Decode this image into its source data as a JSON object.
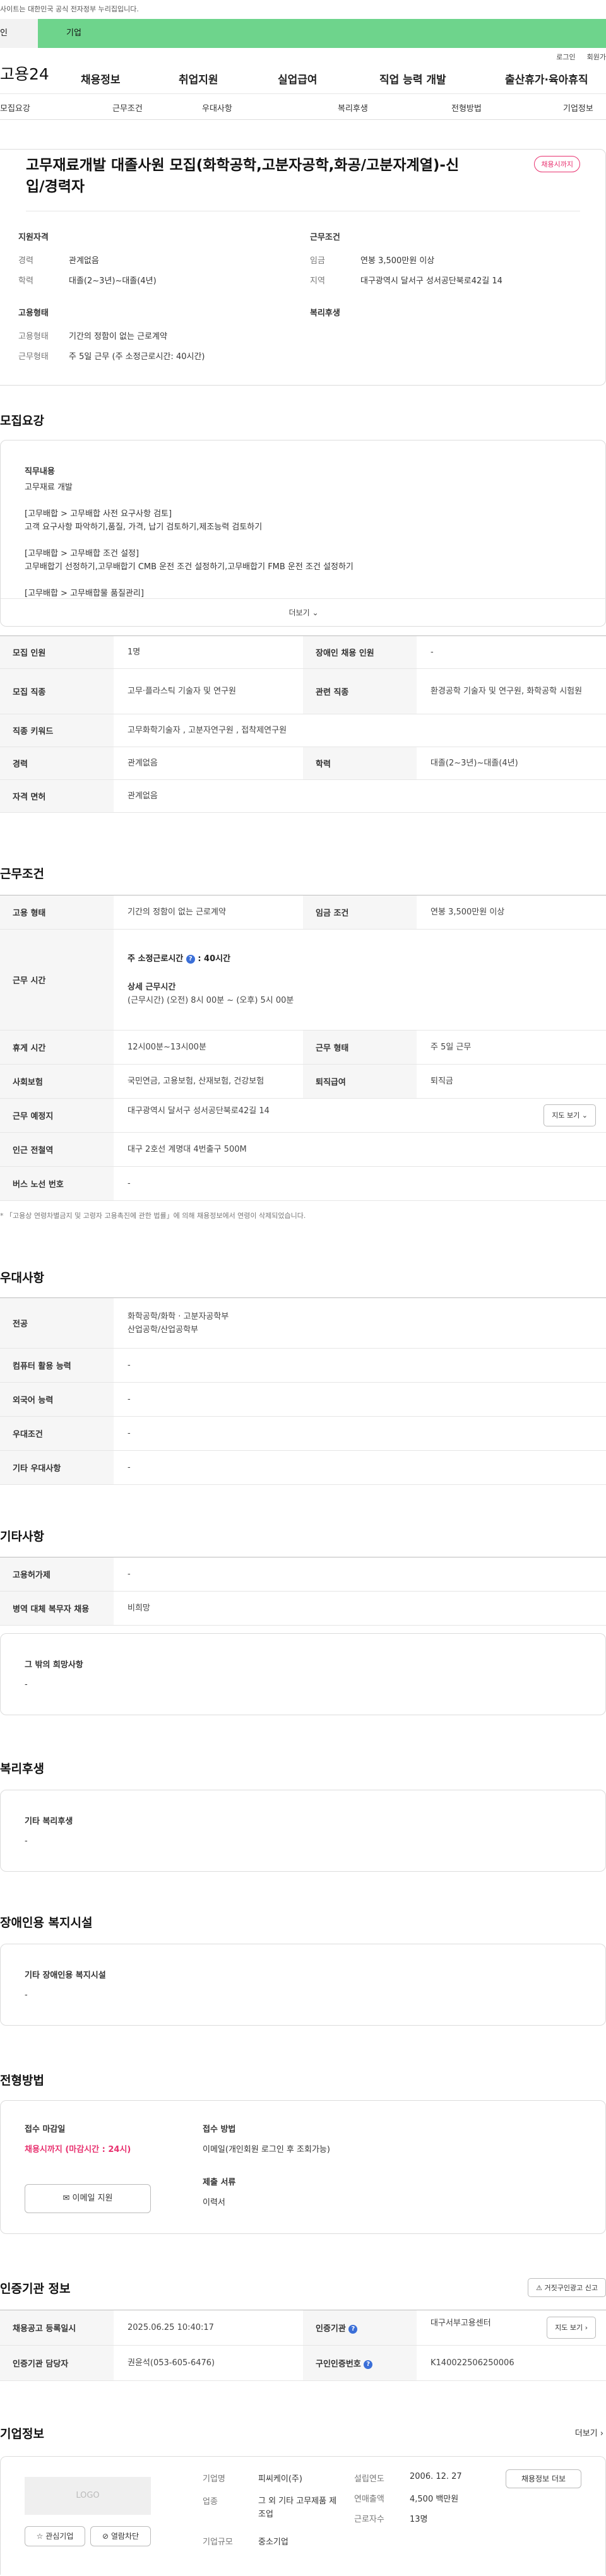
{
  "notice": "사이트는 대한민국 공식 전자정부 누리집입니다.",
  "tabs": {
    "personal": "인",
    "company": "기업"
  },
  "util": {
    "login": "로그인",
    "join": "회원가"
  },
  "logo": "고용24",
  "gnb": [
    "채용정보",
    "취업지원",
    "실업급여",
    "직업 능력 개발",
    "출산휴가·육아휴직"
  ],
  "anchors": [
    "모집요강",
    "근무조건",
    "우대사항",
    "복리후생",
    "전형방법",
    "기업정보"
  ],
  "job": {
    "title": "고무재료개발 대졸사원 모집(화학공학,고분자공학,화공/고분자계열)-신입/경력자",
    "badge": "채용시까지",
    "qual_heading": "지원자격",
    "career_k": "경력",
    "career_v": "관계없음",
    "edu_k": "학력",
    "edu_v": "대졸(2~3년)~대졸(4년)",
    "emp_heading": "고용형태",
    "emptype_k": "고용형태",
    "emptype_v": "기간의 정함이 없는 근로계약",
    "worktype_k": "근무형태",
    "worktype_v": "주 5일 근무 (주 소정근로시간: 40시간)",
    "cond_heading": "근무조건",
    "wage_k": "임금",
    "wage_v": "연봉 3,500만원 이상",
    "region_k": "지역",
    "region_v": "대구광역시 달서구 성서공단북로42길 14",
    "welfare_heading": "복리후생"
  },
  "recruit": {
    "title": "모집요강",
    "duty_heading": "직무내용",
    "duty_text": "고무재료 개발\n\n[고무배합 > 고무배합 사전 요구사항 검토]\n고객 요구사항 파악하기,품질, 가격, 납기 검토하기,제조능력 검토하기\n\n[고무배합 > 고무배합 조건 설정]\n고무배합기 선정하기,고무배합기 CMB 운전 조건 설정하기,고무배합기 FMB 운전 조건 설정하기\n\n[고무배합 > 고무배합물 품질관리]",
    "more": "더보기",
    "rows": [
      {
        "k1": "모집 인원",
        "v1": "1명",
        "k2": "장애인 채용 인원",
        "v2": "-"
      },
      {
        "k1": "모집 직종",
        "v1": "고무·플라스틱 기술자 및 연구원",
        "k2": "관련 직종",
        "v2": "환경공학 기술자 및 연구원, 화학공학 시험원"
      },
      {
        "k1": "직종 키워드",
        "v1": "고무화학기술자 , 고분자연구원 , 접착제연구원"
      },
      {
        "k1": "경력",
        "v1": "관계없음",
        "k2": "학력",
        "v2": "대졸(2~3년)~대졸(4년)"
      },
      {
        "k1": "자격 면허",
        "v1": "관계없음"
      }
    ]
  },
  "work": {
    "title": "근무조건",
    "r1": {
      "k1": "고용 형태",
      "v1": "기간의 정함이 없는 근로계약",
      "k2": "임금 조건",
      "v2": "연봉 3,500만원 이상"
    },
    "hours_k": "근무 시간",
    "hours_week": "주 소정근로시간",
    "hours_week_v": "40시간",
    "hours_detail_h": "상세 근무시간",
    "hours_detail_v": "(근무시간) (오전) 8시 00분 ~ (오후) 5시 00분",
    "r3": {
      "k1": "휴게 시간",
      "v1": "12시00분~13시00분",
      "k2": "근무 형태",
      "v2": "주 5일 근무"
    },
    "r4": {
      "k1": "사회보험",
      "v1": "국민연금, 고용보험, 산재보험, 건강보험",
      "k2": "퇴직급여",
      "v2": "퇴직금"
    },
    "r5": {
      "k1": "근무 예정지",
      "v1": "대구광역시 달서구 성서공단북로42길 14",
      "btn": "지도 보기"
    },
    "r6": {
      "k1": "인근 전철역",
      "v1": "대구 2호선 계명대 4번출구 500M"
    },
    "r7": {
      "k1": "버스 노선 번호",
      "v1": "-"
    },
    "note": "* 「고용상 연령차별금지 및 고령자 고용촉진에 관한 법률」에 의해 채용정보에서 연령이 삭제되었습니다."
  },
  "prefer": {
    "title": "우대사항",
    "rows": [
      {
        "k": "전공",
        "v": "화학공학/화학 · 고분자공학부\n산업공학/산업공학부"
      },
      {
        "k": "컴퓨터 활용 능력",
        "v": "-"
      },
      {
        "k": "외국어 능력",
        "v": "-"
      },
      {
        "k": "우대조건",
        "v": "-"
      },
      {
        "k": "기타 우대사항",
        "v": "-"
      }
    ]
  },
  "etc": {
    "title": "기타사항",
    "rows": [
      {
        "k": "고용허가제",
        "v": "-"
      },
      {
        "k": "병역 대체 복무자 채용",
        "v": "비희망"
      }
    ],
    "other_h": "그 밖의 희망사항",
    "other_v": "-"
  },
  "welfare": {
    "title": "복리후생",
    "h": "기타 복리후생",
    "v": "-"
  },
  "disabled": {
    "title": "장애인용 복지시설",
    "h": "기타 장애인용 복지시설",
    "v": "-"
  },
  "selection": {
    "title": "전형방법",
    "deadline_h": "접수 마감일",
    "deadline_v": "채용시까지 (마감시간 : 24시)",
    "method_h": "접수 방법",
    "method_v": "이메일(개인회원 로그인 후 조회가능)",
    "docs_h": "제출 서류",
    "docs_v": "이력서",
    "email_btn": "이메일 지원"
  },
  "cert": {
    "title": "인증기관 정보",
    "report_btn": "거짓구인광고 신고",
    "r1": {
      "k1": "채용공고 등록일시",
      "v1": "2025.06.25 10:40:17",
      "k2": "인증기관",
      "v2": "대구서부고용센터",
      "btn": "지도 보기"
    },
    "r2": {
      "k1": "인증기관 담당자",
      "v1": "권윤석(053-605-6476)",
      "k2": "구인인증번호",
      "v2": "K140022506250006"
    }
  },
  "company": {
    "title": "기업정보",
    "more": "더보기",
    "logo": "LOGO",
    "fav_btn": "관심기업",
    "block_btn": "열람차단",
    "name_k": "기업명",
    "name_v": "피씨케이(주)",
    "ind_k": "업종",
    "ind_v": "그 외 기타 고무제품 제조업",
    "size_k": "기업규모",
    "size_v": "중소기업",
    "est_k": "설립연도",
    "est_v": "2006. 12. 27",
    "sales_k": "연매출액",
    "sales_v": "4,500 백만원",
    "emp_k": "근로자수",
    "emp_v": "13명",
    "jobs_btn": "채용정보 더보"
  },
  "colors": {
    "green": "#6ed48c",
    "accent": "#e8316f",
    "blue_icon": "#3b6fd8"
  }
}
